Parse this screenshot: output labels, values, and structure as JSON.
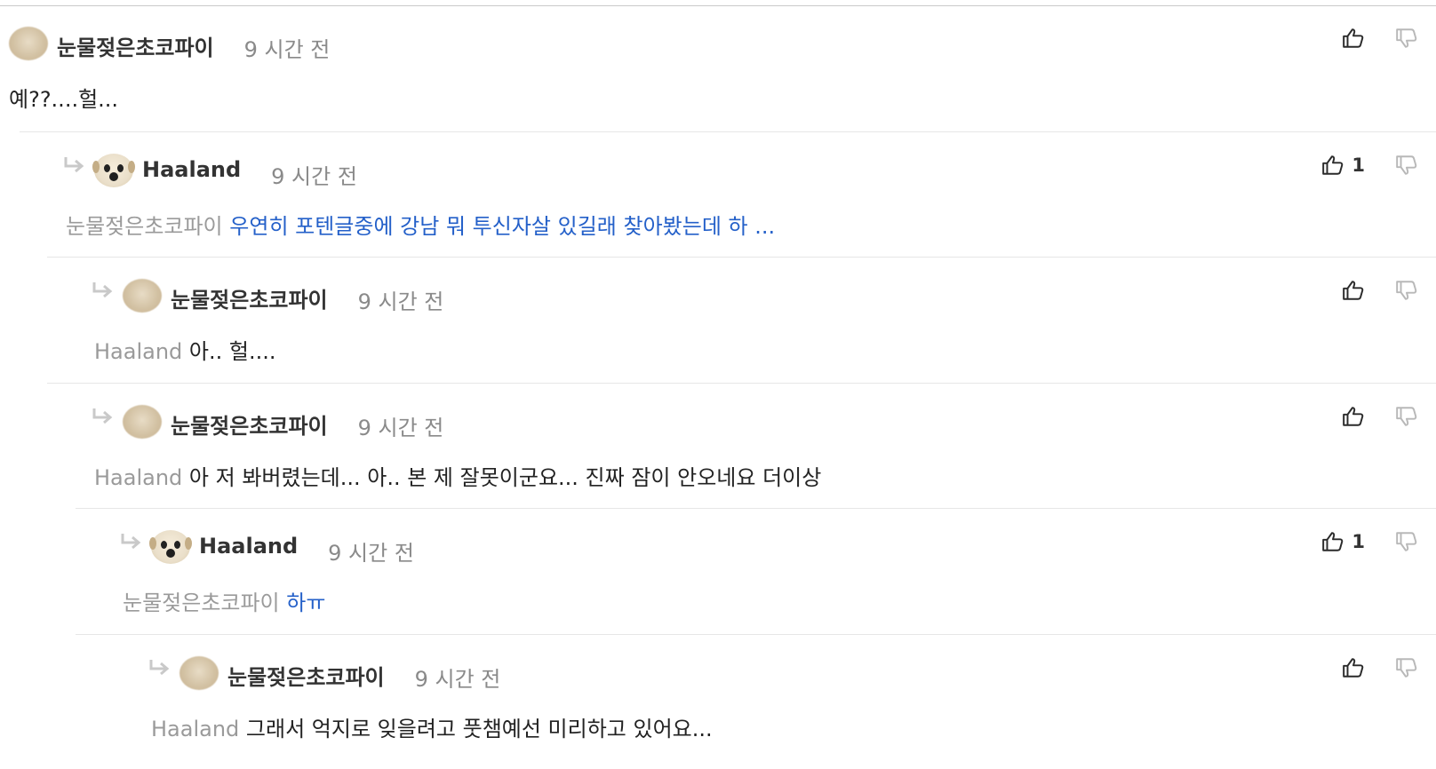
{
  "thread": {
    "comments": [
      {
        "author": "눈물젖은초코파이",
        "avatar": "blurred-avatar",
        "time": "9 시간 전",
        "mention": "",
        "text": "예??....헐...",
        "text_style": "plain",
        "likes": "",
        "is_reply": false,
        "indent": 0
      },
      {
        "author": "Haaland",
        "avatar": "dog-avatar",
        "time": "9 시간 전",
        "mention": "눈물젖은초코파이",
        "text": "우연히 포텐글중에 강남 뭐 투신자살 있길래 찾아봤는데 하 ...",
        "text_style": "link",
        "likes": "1",
        "is_reply": true,
        "indent": 1
      },
      {
        "author": "눈물젖은초코파이",
        "avatar": "blurred-avatar",
        "time": "9 시간 전",
        "mention": "Haaland",
        "text": "아.. 헐....",
        "text_style": "plain",
        "likes": "",
        "is_reply": true,
        "indent": 2
      },
      {
        "author": "눈물젖은초코파이",
        "avatar": "blurred-avatar",
        "time": "9 시간 전",
        "mention": "Haaland",
        "text": "아 저 봐버렸는데... 아.. 본 제 잘못이군요... 진짜 잠이 안오네요 더이상",
        "text_style": "plain",
        "likes": "",
        "is_reply": true,
        "indent": 2
      },
      {
        "author": "Haaland",
        "avatar": "dog-avatar",
        "time": "9 시간 전",
        "mention": "눈물젖은초코파이",
        "text": "하ㅠ",
        "text_style": "link",
        "likes": "1",
        "is_reply": true,
        "indent": 3
      },
      {
        "author": "눈물젖은초코파이",
        "avatar": "blurred-avatar",
        "time": "9 시간 전",
        "mention": "Haaland",
        "text": "그래서 억지로 잊을려고 풋챔예선 미리하고 있어요...",
        "text_style": "plain",
        "likes": "",
        "is_reply": true,
        "indent": 4
      }
    ]
  },
  "icons": {
    "like": "thumbs-up-icon",
    "dislike": "thumbs-down-icon",
    "reply": "reply-arrow-icon"
  },
  "colors": {
    "mention": "#9a9a9a",
    "link_text": "#2460c9",
    "time": "#8a8a8a",
    "separator": "#e6e6e6"
  }
}
